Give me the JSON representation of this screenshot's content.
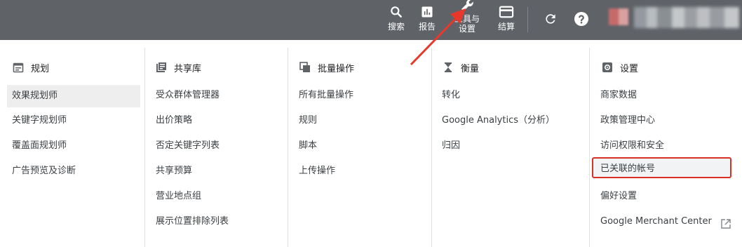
{
  "toolbar": {
    "search_label": "搜索",
    "report_label": "报告",
    "tools_label_line1": "工具与",
    "tools_label_line2": "设置",
    "billing_label": "结算"
  },
  "icons": {
    "search": "search-icon",
    "report": "bar-chart-icon",
    "tools": "wrench-icon",
    "billing": "credit-card-icon",
    "refresh": "refresh-icon",
    "help": "help-icon",
    "external": "external-link-icon"
  },
  "colors": {
    "topbar": "#5f6368",
    "annotation": "#e8382b",
    "active_bg": "#eeeeee"
  },
  "columns": [
    {
      "header": "规划",
      "items": [
        "效果规划师",
        "关键字规划师",
        "覆盖面规划师",
        "广告预览及诊断"
      ]
    },
    {
      "header": "共享库",
      "items": [
        "受众群体管理器",
        "出价策略",
        "否定关键字列表",
        "共享预算",
        "营业地点组",
        "展示位置排除列表"
      ]
    },
    {
      "header": "批量操作",
      "items": [
        "所有批量操作",
        "规则",
        "脚本",
        "上传操作"
      ]
    },
    {
      "header": "衡量",
      "items": [
        "转化",
        "Google Analytics（分析）",
        "归因"
      ]
    },
    {
      "header": "设置",
      "items": [
        "商家数据",
        "政策管理中心",
        "访问权限和安全",
        "已关联的帐号",
        "偏好设置",
        "Google Merchant Center"
      ]
    }
  ]
}
